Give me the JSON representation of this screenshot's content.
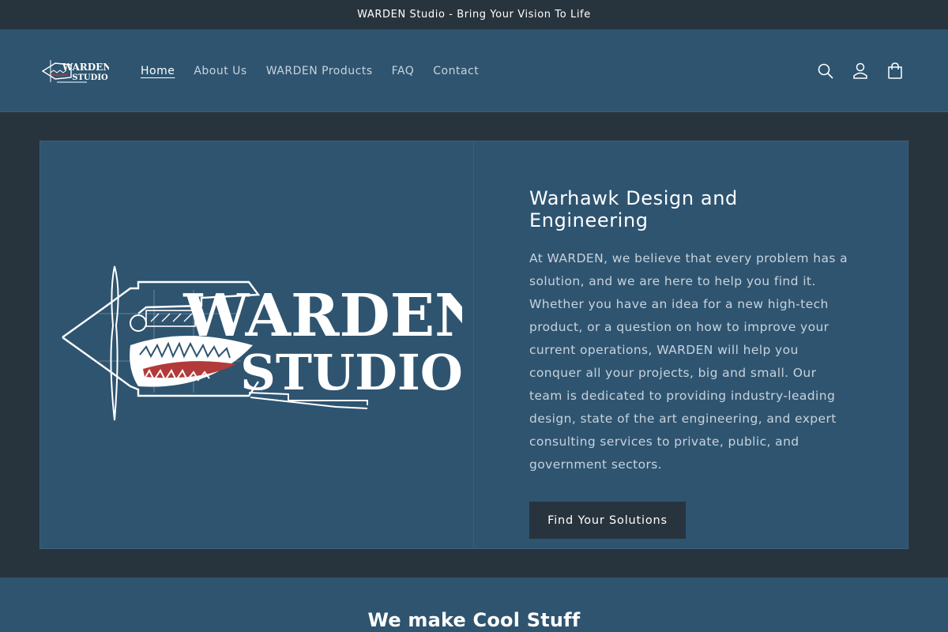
{
  "announcement": {
    "text": "WARDEN Studio - Bring Your Vision To Life"
  },
  "header": {
    "logo_alt": "WARDEN STUDIO",
    "logo_lines": [
      "WARDEN",
      "STUDIO"
    ],
    "nav": [
      {
        "label": "Home",
        "active": true
      },
      {
        "label": "About Us",
        "active": false
      },
      {
        "label": "WARDEN Products",
        "active": false
      },
      {
        "label": "FAQ",
        "active": false
      },
      {
        "label": "Contact",
        "active": false
      }
    ],
    "icons": [
      "search-icon",
      "account-icon",
      "cart-icon"
    ]
  },
  "hero": {
    "image_text": [
      "WARDEN",
      "STUDIO"
    ],
    "title": "Warhawk Design and Engineering",
    "body": "At WARDEN, we believe that every problem has a solution, and we are here to help you find it. Whether you have an idea for a new high-tech product, or a question on how to improve your current operations, WARDEN will help you conquer all your projects, big and small. Our team is dedicated to providing industry-leading design, state of the art engineering, and expert consulting services to private, public, and government sectors.",
    "cta_label": "Find Your Solutions"
  },
  "section2": {
    "heading": "We make Cool Stuff"
  },
  "colors": {
    "background": "#28343d",
    "panel": "#2e5470",
    "accent_red": "#b23a3a",
    "text": "#ffffff",
    "muted_text": "#c8d3dc"
  }
}
